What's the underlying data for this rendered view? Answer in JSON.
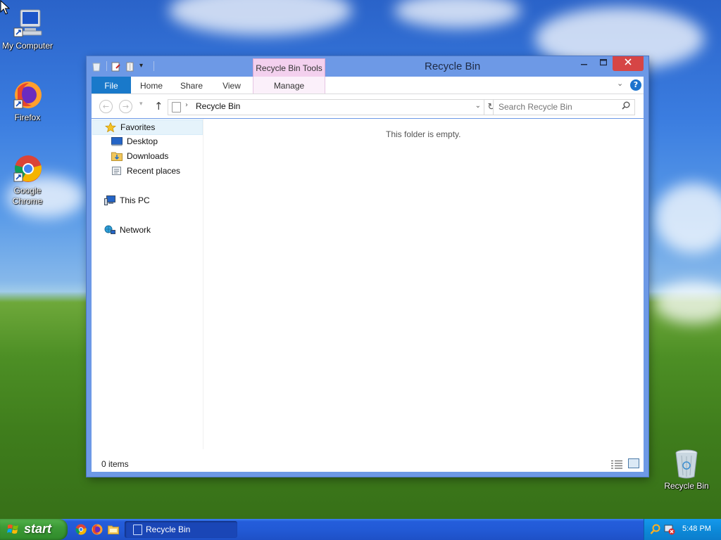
{
  "desktop": {
    "icons": [
      {
        "label": "My Computer"
      },
      {
        "label": "Firefox"
      },
      {
        "label": "Google Chrome"
      },
      {
        "label": "Recycle Bin"
      }
    ]
  },
  "window": {
    "title": "Recycle Bin",
    "context_tab": "Recycle Bin Tools",
    "ribbon_tabs": [
      "File",
      "Home",
      "Share",
      "View",
      "Manage"
    ],
    "help_label": "?",
    "address": {
      "path": "Recycle Bin"
    },
    "search": {
      "placeholder": "Search Recycle Bin"
    },
    "nav": {
      "favorites": "Favorites",
      "desktop": "Desktop",
      "downloads": "Downloads",
      "recent": "Recent places",
      "this_pc": "This PC",
      "network": "Network"
    },
    "empty_message": "This folder is empty.",
    "status": "0 items"
  },
  "taskbar": {
    "start_label": "start",
    "task_label": "Recycle Bin",
    "clock": "5:48 PM"
  },
  "colors": {
    "file_tab": "#1979ca",
    "context_tab": "#f3d0ee",
    "taskbar": "#225ad6",
    "start": "#3c9a36",
    "close": "#d64545"
  }
}
